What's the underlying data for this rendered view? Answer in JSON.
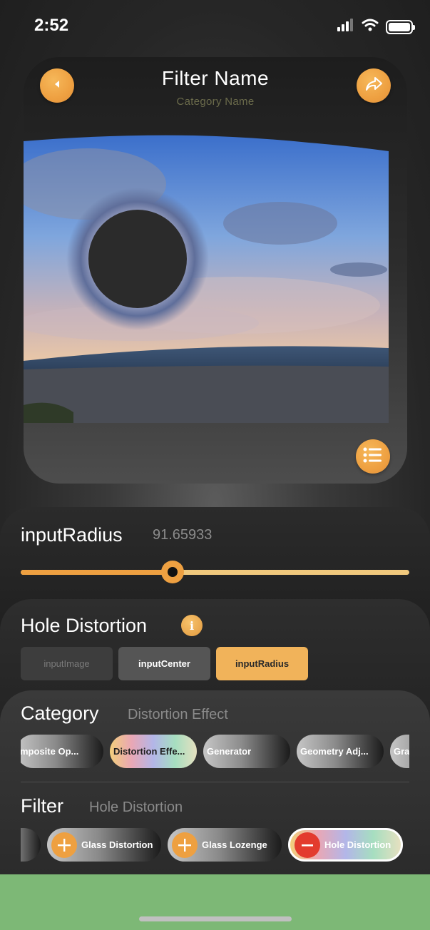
{
  "status": {
    "time": "2:52",
    "signal_icon": "signal-bars-icon",
    "wifi_icon": "wifi-icon",
    "battery_icon": "battery-icon"
  },
  "header": {
    "title": "Filter Name",
    "subtitle": "Category Name",
    "back_icon": "back-arrow-icon",
    "share_icon": "share-arrow-icon",
    "list_icon": "list-icon"
  },
  "parameter": {
    "name": "inputRadius",
    "value": "91.65933",
    "slider_fraction": 0.39
  },
  "filter_info": {
    "name": "Hole Distortion",
    "info_icon": "info-icon",
    "info_glyph": "i",
    "inputs": [
      {
        "label": "inputImage",
        "state": "disabled"
      },
      {
        "label": "inputCenter",
        "state": "normal"
      },
      {
        "label": "inputRadius",
        "state": "active"
      }
    ]
  },
  "category": {
    "title": "Category",
    "selected": "Distortion Effect",
    "chips": [
      "mposite Op...",
      "Distortion Effe...",
      "Generator",
      "Geometry Adj...",
      "Gradi"
    ]
  },
  "filter": {
    "title": "Filter",
    "selected": "Hole Distortion",
    "chips": [
      "Glass Distortion",
      "Glass Lozenge",
      "Hole Distortion"
    ]
  },
  "colors": {
    "accent": "#eea041",
    "bottom_bar": "#7db876",
    "remove": "#e33b2e"
  }
}
